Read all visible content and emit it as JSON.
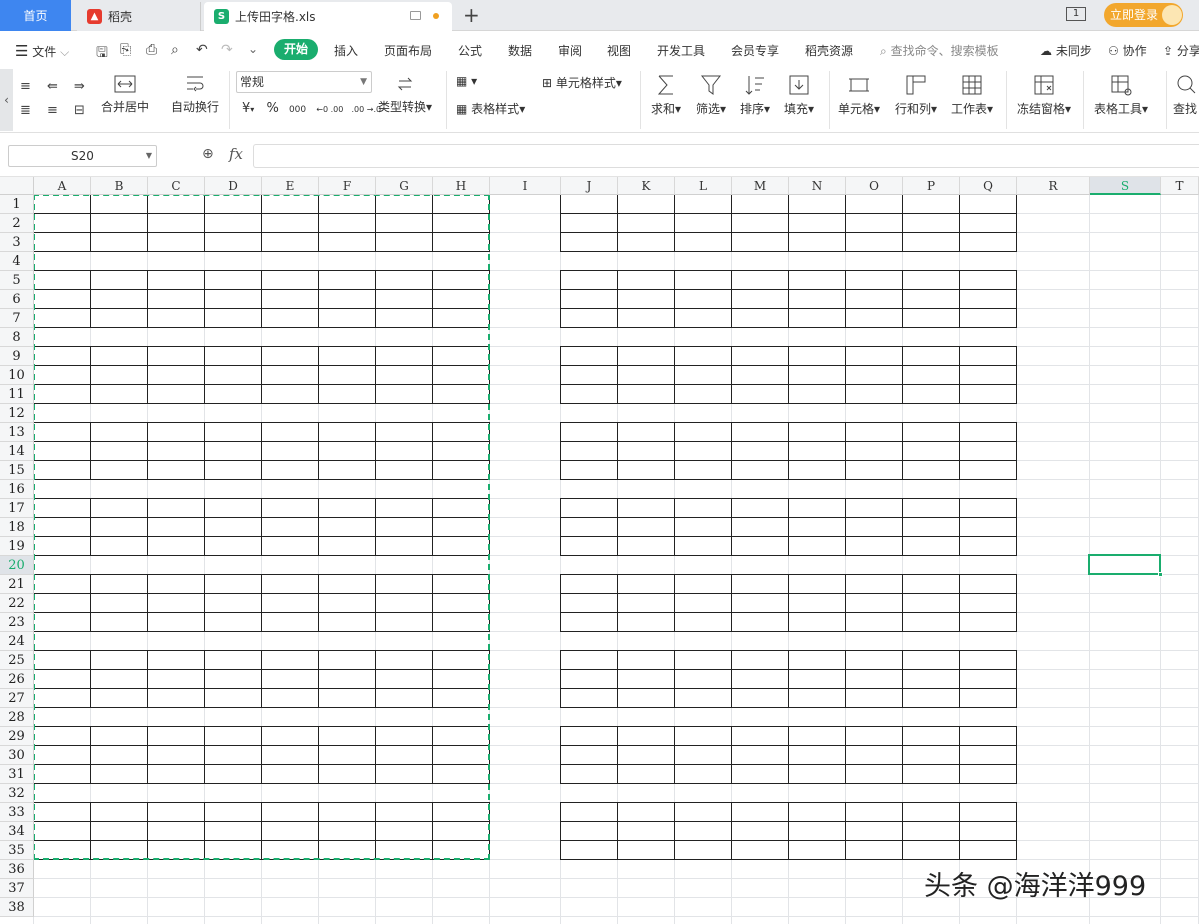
{
  "tabs": {
    "home": "首页",
    "daoke": "稻壳",
    "file": "上传田字格.xls",
    "add": "+",
    "page_indicator": "1",
    "login": "立即登录"
  },
  "menu": {
    "file": "文件",
    "items": [
      "开始",
      "插入",
      "页面布局",
      "公式",
      "数据",
      "审阅",
      "视图",
      "开发工具",
      "会员专享",
      "稻壳资源"
    ],
    "search_placeholder": "查找命令、搜索模板",
    "sync": "未同步",
    "collab": "协作",
    "share": "分享"
  },
  "ribbon": {
    "merge": "合并居中",
    "wrap": "自动换行",
    "number_format": "常规",
    "currency": "¥",
    "percent": "%",
    "thousands": "000",
    "inc_decimal": "←0 .00",
    "dec_decimal": ".00 →.0",
    "type_convert": "类型转换",
    "cell_style": "单元格样式",
    "table_style": "表格样式",
    "sum": "求和",
    "filter": "筛选",
    "sort": "排序",
    "fill": "填充",
    "cells": "单元格",
    "rows_cols": "行和列",
    "worksheet": "工作表",
    "freeze": "冻结窗格",
    "table_tools": "表格工具",
    "find": "查找"
  },
  "formula_bar": {
    "cell_ref": "S20",
    "fx": "fx",
    "value": ""
  },
  "grid": {
    "columns": [
      "A",
      "B",
      "C",
      "D",
      "E",
      "F",
      "G",
      "H",
      "I",
      "J",
      "K",
      "L",
      "M",
      "N",
      "O",
      "P",
      "Q",
      "R",
      "S",
      "T"
    ],
    "rows": [
      "1",
      "2",
      "3",
      "4",
      "5",
      "6",
      "7",
      "8",
      "9",
      "10",
      "11",
      "12",
      "13",
      "14",
      "15",
      "16",
      "17",
      "18",
      "19",
      "20",
      "21",
      "22",
      "23",
      "24",
      "25",
      "26",
      "27",
      "28",
      "29",
      "30",
      "31",
      "32",
      "33",
      "34",
      "35",
      "36",
      "37",
      "38"
    ],
    "selected_cell": "S20",
    "accent": "#1aad6e"
  },
  "watermark": "头条 @海洋洋999"
}
